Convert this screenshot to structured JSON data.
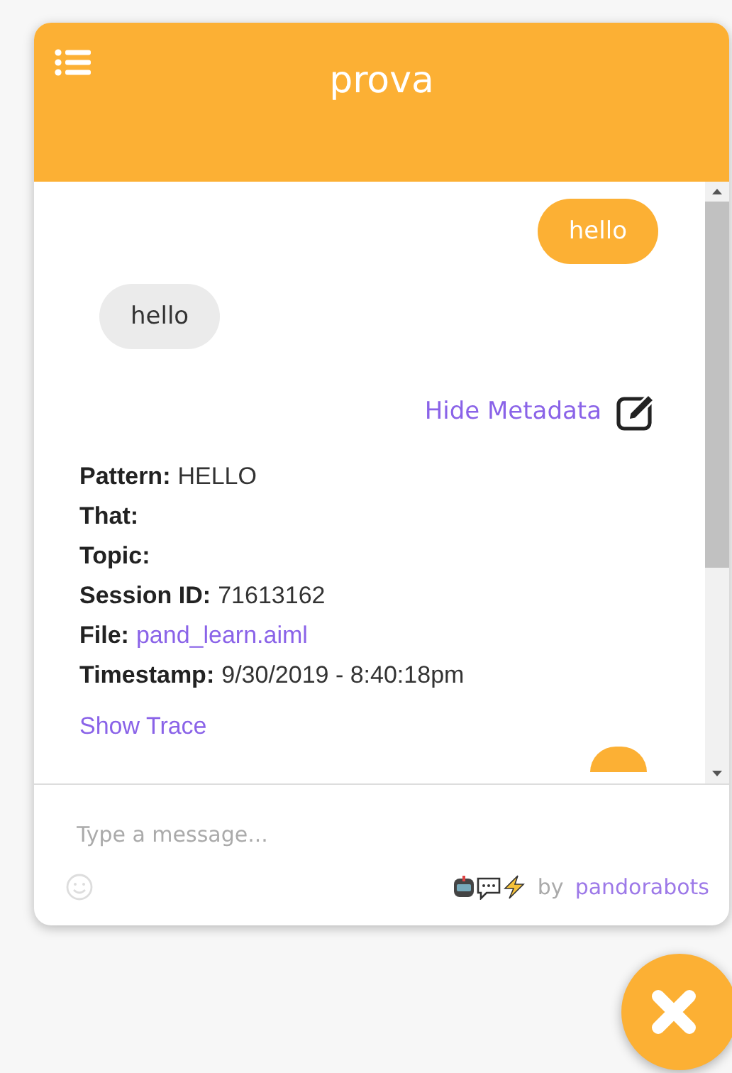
{
  "header": {
    "title": "prova"
  },
  "messages": [
    {
      "kind": "user",
      "text": "hello"
    },
    {
      "kind": "bot",
      "text": "hello"
    }
  ],
  "metadata_toggle": {
    "label": "Hide Metadata"
  },
  "metadata": [
    {
      "label": "Pattern:",
      "value": "HELLO",
      "kind": "text"
    },
    {
      "label": "That:"
    },
    {
      "label": "Topic:"
    },
    {
      "label": "Session ID:",
      "value": "71613162",
      "kind": "text"
    },
    {
      "label": "File:",
      "value": "pand_learn.aiml",
      "kind": "link"
    },
    {
      "label": "Timestamp:",
      "value": "9/30/2019 - 8:40:18pm",
      "kind": "text"
    }
  ],
  "trace_link": "Show Trace",
  "composer": {
    "placeholder": "Type a message..."
  },
  "branding": {
    "by": "by",
    "brand": "pandorabots"
  }
}
